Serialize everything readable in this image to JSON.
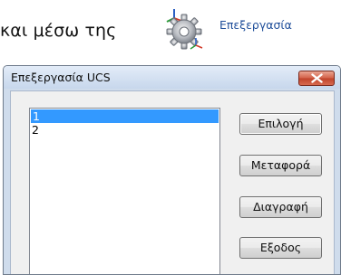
{
  "caption": {
    "text": "και μέσω της",
    "tool_label": "Επεξεργασία",
    "tool_icon": "ucs-edit-icon"
  },
  "dialog": {
    "title": "Επεξεργασία UCS",
    "close_icon": "close-icon",
    "list_items": [
      "1",
      "2"
    ],
    "selected_index": 0,
    "buttons": {
      "select": "Επιλογή",
      "move": "Μεταφορά",
      "delete": "Διαγραφή",
      "exit": "Εξοδος"
    }
  },
  "colors": {
    "selection": "#3399ff",
    "close_button": "#c7452d",
    "titlebar": "#c7d7ec",
    "tool_label": "#1f4e9a"
  }
}
